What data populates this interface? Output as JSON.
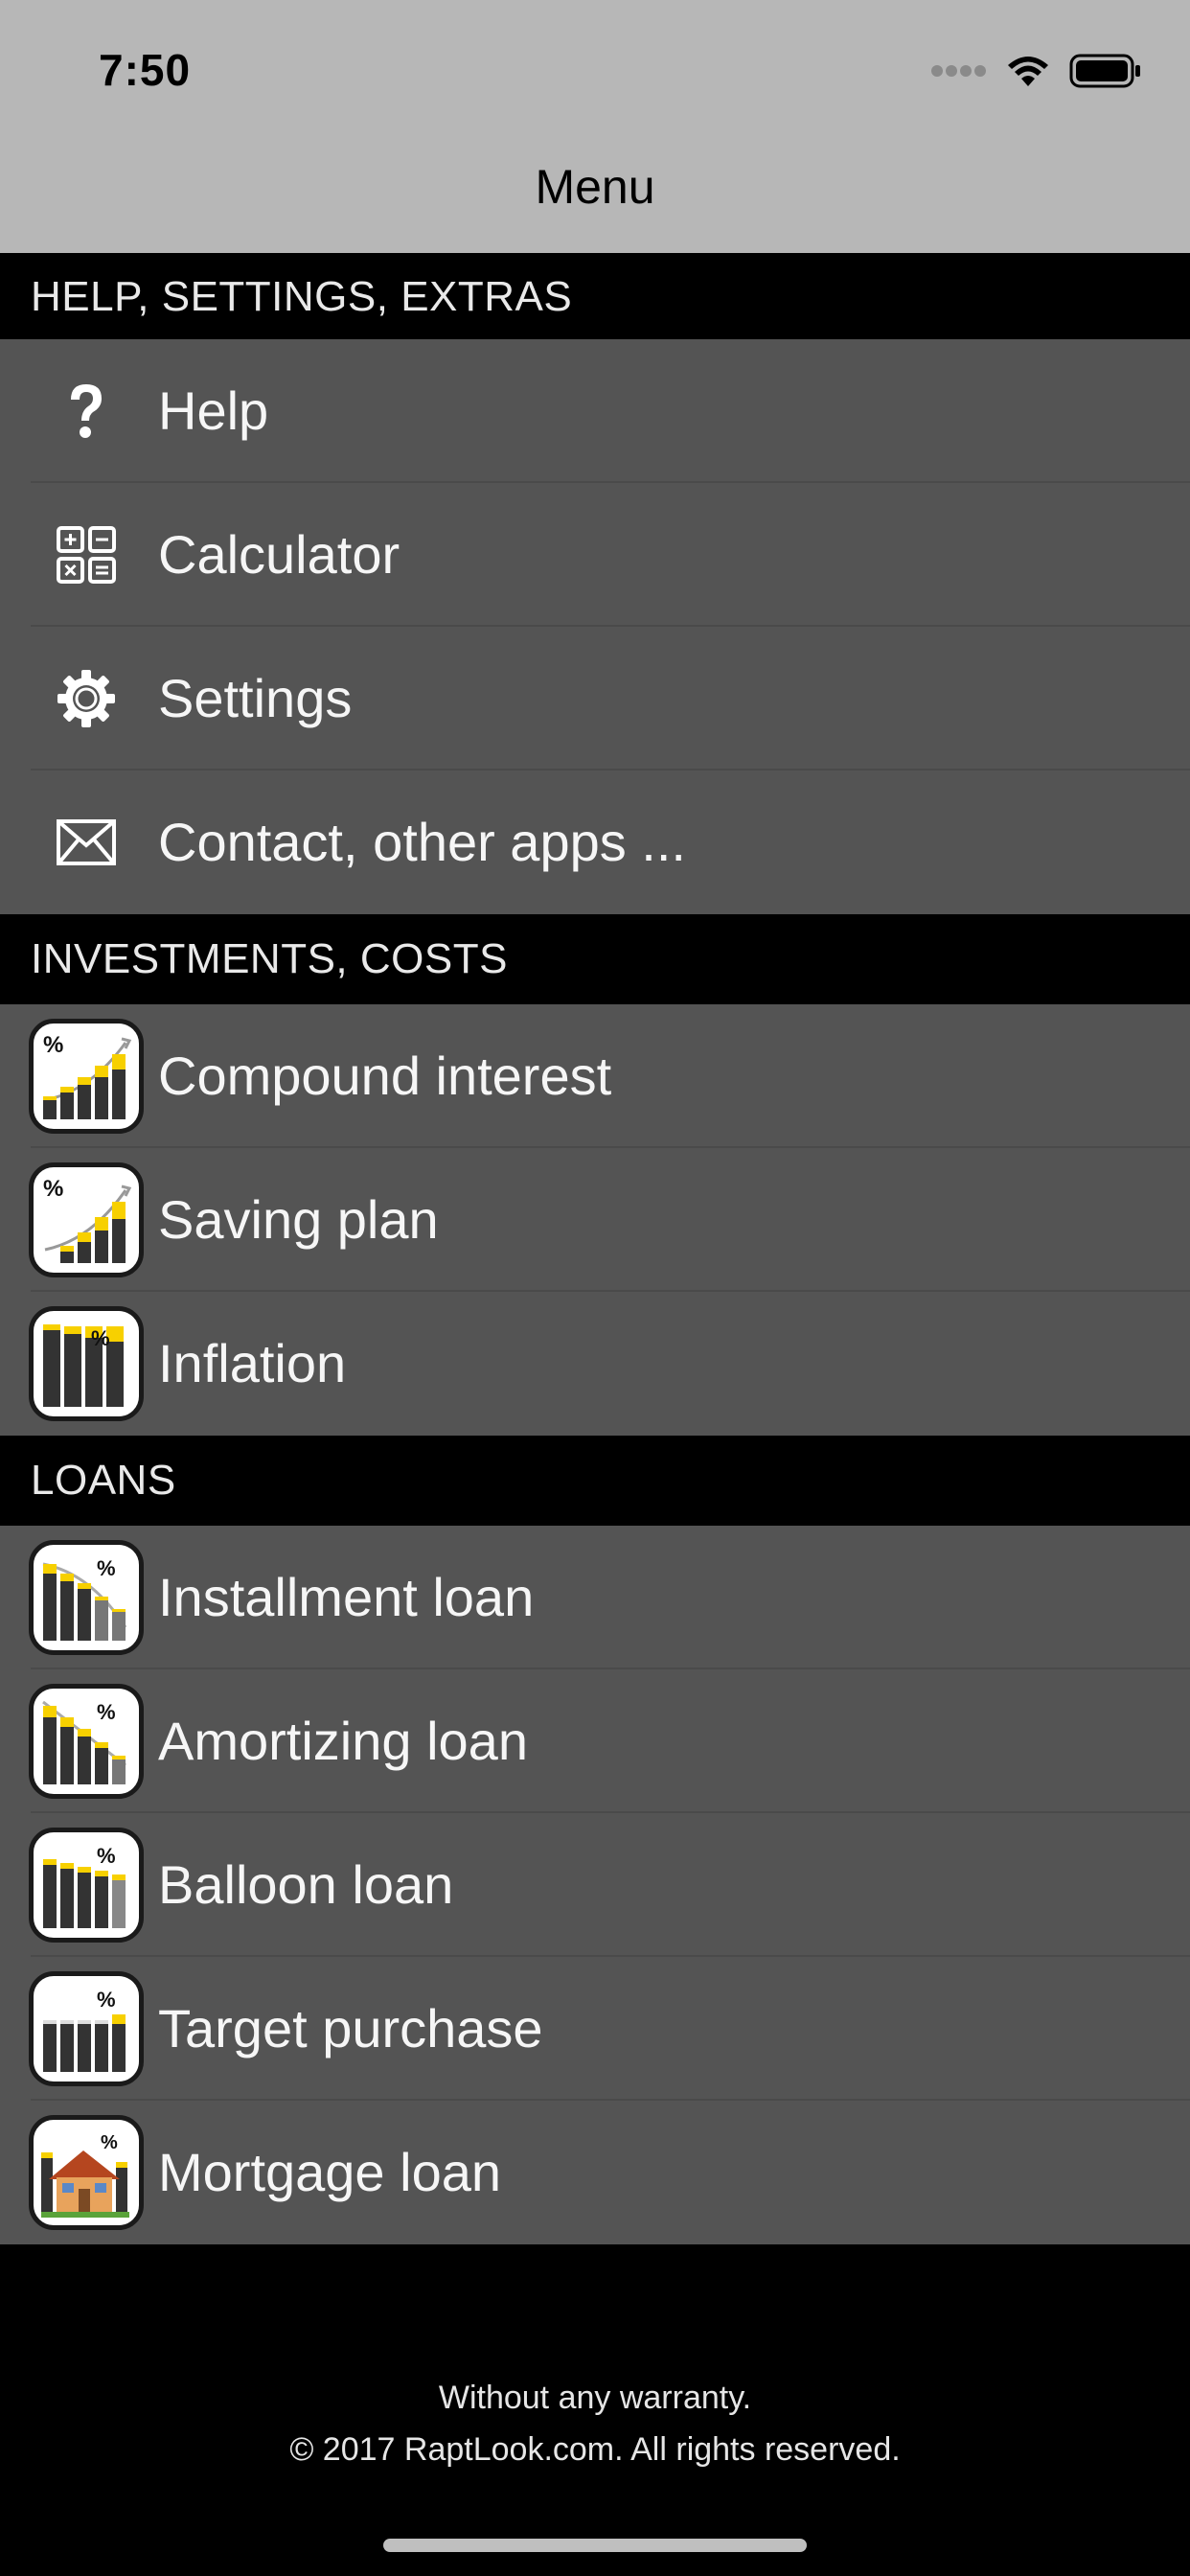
{
  "status_bar": {
    "time": "7:50"
  },
  "nav": {
    "title": "Menu"
  },
  "sections": {
    "help": {
      "header": "HELP, SETTINGS, EXTRAS",
      "items": [
        "Help",
        "Calculator",
        "Settings",
        "Contact, other apps ..."
      ]
    },
    "investments": {
      "header": "INVESTMENTS, COSTS",
      "items": [
        "Compound interest",
        "Saving plan",
        "Inflation"
      ]
    },
    "loans": {
      "header": "LOANS",
      "items": [
        "Installment loan",
        "Amortizing loan",
        "Balloon loan",
        "Target purchase",
        "Mortgage loan"
      ]
    }
  },
  "footer": {
    "line1": "Without any warranty.",
    "line2": "© 2017 RaptLook.com. All rights reserved."
  },
  "icons": {
    "help": "question-mark-icon",
    "calculator": "calculator-icon",
    "settings": "gear-icon",
    "contact": "envelope-icon",
    "compound": "compound-interest-icon",
    "saving": "saving-plan-icon",
    "inflation": "inflation-icon",
    "installment": "installment-loan-icon",
    "amortizing": "amortizing-loan-icon",
    "balloon": "balloon-loan-icon",
    "target": "target-purchase-icon",
    "mortgage": "mortgage-loan-icon"
  },
  "colors": {
    "nav_background": "#b7b7b7",
    "row_background": "#545454",
    "section_background": "#000000",
    "chart_yellow": "#f7d000"
  }
}
